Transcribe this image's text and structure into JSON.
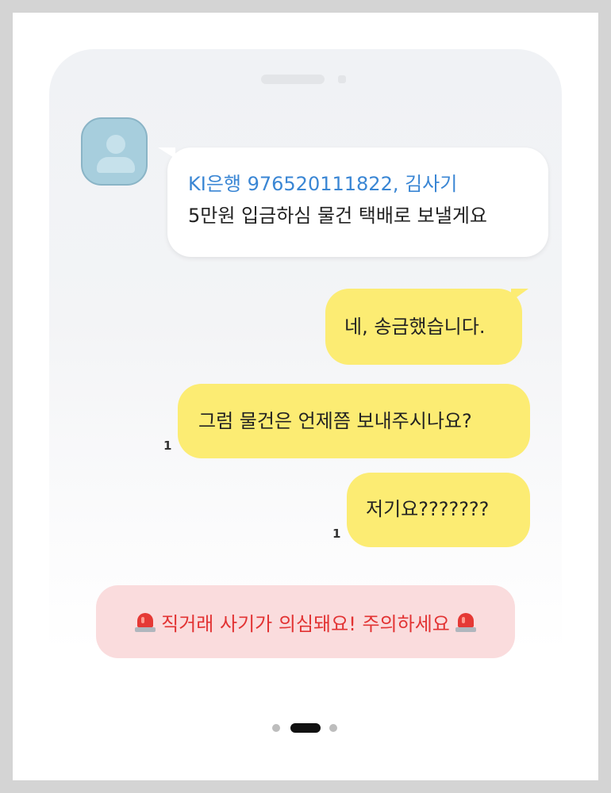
{
  "messages": {
    "incoming": {
      "account_line": "KI은행 976520111822, 김사기",
      "text": "5만원 입금하심 물건 택배로 보낼게요"
    },
    "outgoing": [
      {
        "text": "네, 송금했습니다.",
        "unread": ""
      },
      {
        "text": "그럼 물건은 언제쯤 보내주시나요?",
        "unread": "1"
      },
      {
        "text": "저기요???????",
        "unread": "1"
      }
    ]
  },
  "warning": {
    "text": "직거래 사기가 의심돼요! 주의하세요",
    "icon": "siren-icon",
    "color": "#e23333",
    "background": "#fadcdd"
  },
  "pager": {
    "total": 3,
    "active": 2
  },
  "colors": {
    "outgoing_bubble": "#fcec73",
    "incoming_bubble": "#ffffff",
    "account_text": "#3a86d4"
  }
}
